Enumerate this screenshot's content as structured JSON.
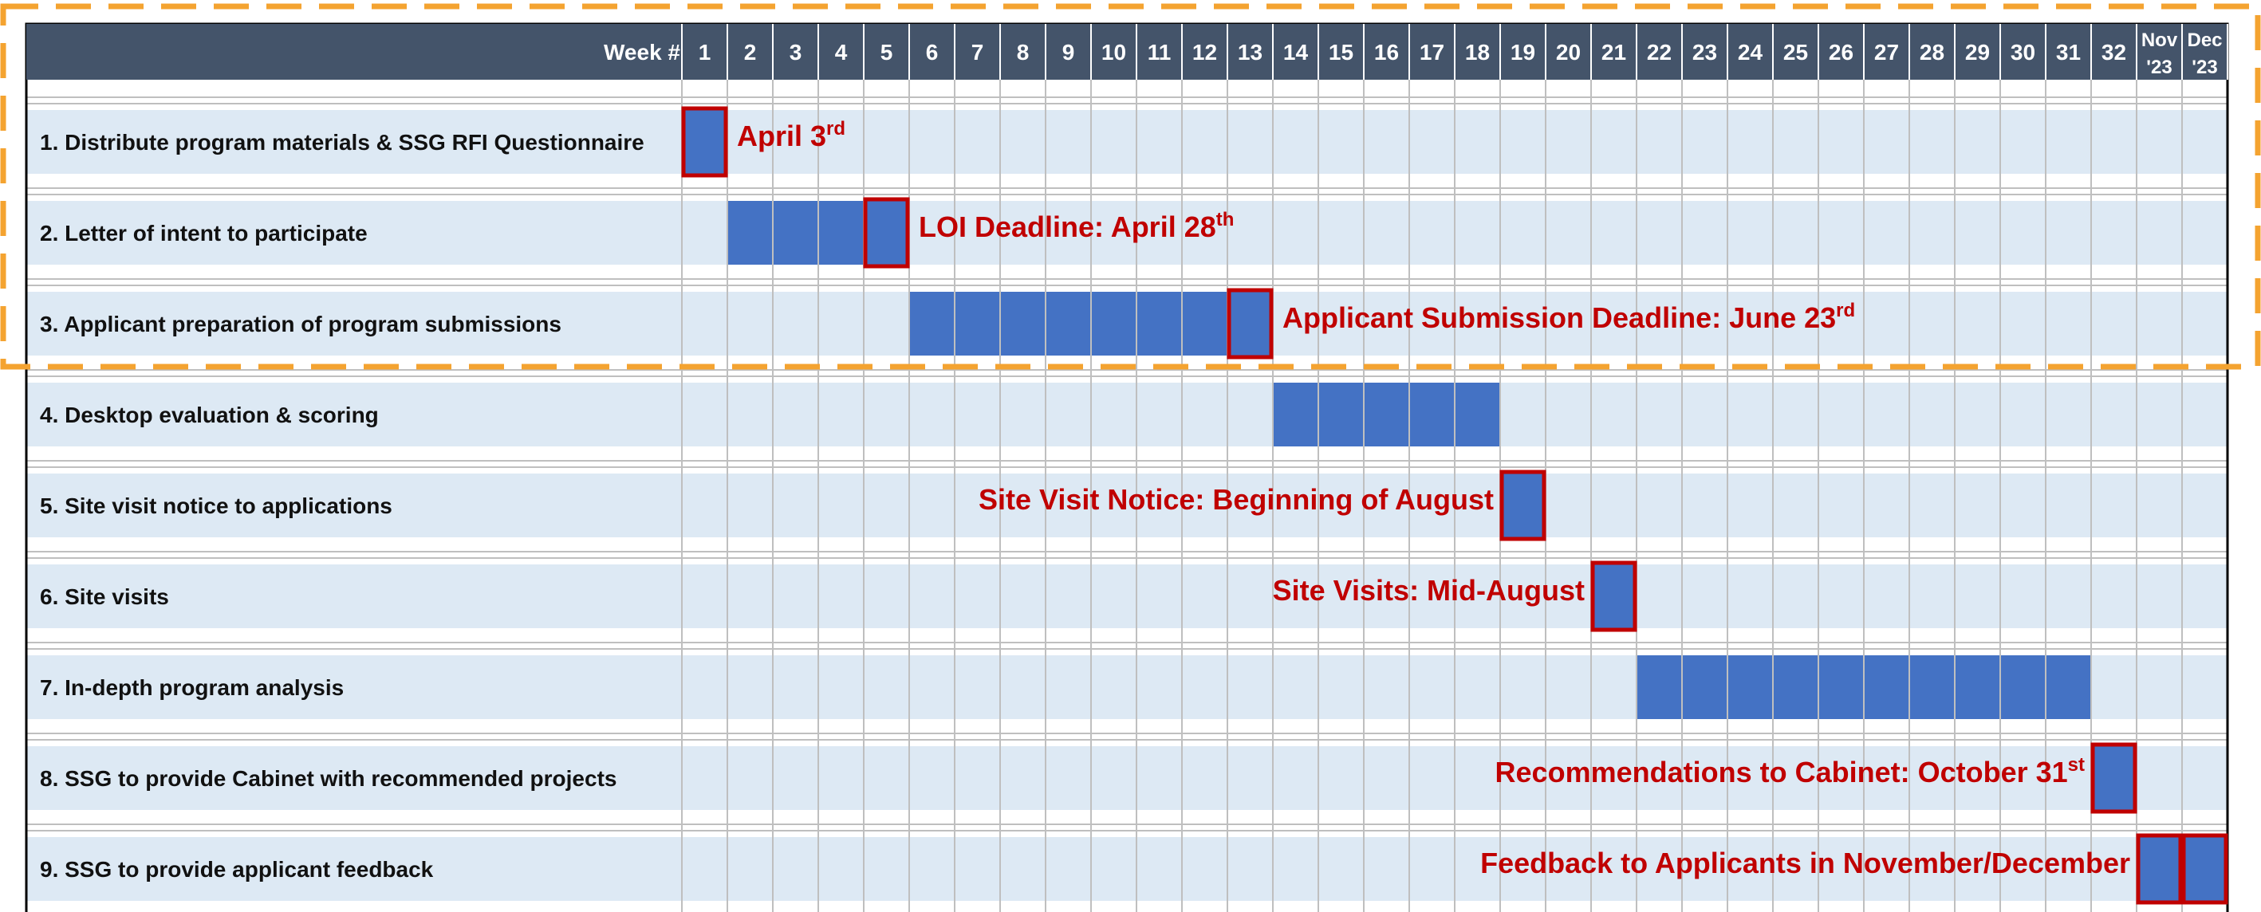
{
  "colors": {
    "header_bg": "#44546a",
    "row_band": "#dde9f4",
    "bar_fill": "#4472c4",
    "milestone_border": "#c00000",
    "annotation_text": "#c00000",
    "highlight_dash": "#f4a330",
    "grid_line": "#bfbfbf"
  },
  "chart_data": {
    "type": "gantt",
    "header_label": "Week #",
    "columns": [
      "1",
      "2",
      "3",
      "4",
      "5",
      "6",
      "7",
      "8",
      "9",
      "10",
      "11",
      "12",
      "13",
      "14",
      "15",
      "16",
      "17",
      "18",
      "19",
      "20",
      "21",
      "22",
      "23",
      "24",
      "25",
      "26",
      "27",
      "28",
      "29",
      "30",
      "31",
      "32",
      [
        "Nov",
        "'23"
      ],
      [
        "Dec",
        "'23"
      ]
    ],
    "tasks": [
      {
        "label": "1. Distribute program materials & SSG RFI Questionnaire",
        "start": 1,
        "end": 1,
        "milestones": [
          1
        ],
        "annotation": {
          "text": "April 3",
          "sup": "rd",
          "side": "right"
        }
      },
      {
        "label": "2. Letter of intent to participate",
        "start": 2,
        "end": 5,
        "milestones": [
          5
        ],
        "annotation": {
          "text": "LOI Deadline: April 28",
          "sup": "th",
          "side": "right"
        }
      },
      {
        "label": "3. Applicant preparation of program submissions",
        "start": 6,
        "end": 13,
        "milestones": [
          13
        ],
        "annotation": {
          "text": "Applicant Submission Deadline: June 23",
          "sup": "rd",
          "side": "right"
        }
      },
      {
        "label": "4. Desktop evaluation & scoring",
        "start": 14,
        "end": 18,
        "milestones": []
      },
      {
        "label": "5. Site visit notice to applications",
        "start": 19,
        "end": 19,
        "milestones": [
          19
        ],
        "annotation": {
          "text": "Site Visit Notice: Beginning of August",
          "sup": "",
          "side": "left"
        }
      },
      {
        "label": "6. Site visits",
        "start": 21,
        "end": 21,
        "milestones": [
          21
        ],
        "annotation": {
          "text": "Site Visits: Mid-August",
          "sup": "",
          "side": "left"
        }
      },
      {
        "label": "7. In-depth program analysis",
        "start": 22,
        "end": 31,
        "milestones": []
      },
      {
        "label": "8. SSG to provide Cabinet with recommended projects",
        "start": 32,
        "end": 32,
        "milestones": [
          32
        ],
        "annotation": {
          "text": "Recommendations to Cabinet: October 31",
          "sup": "st",
          "side": "left"
        }
      },
      {
        "label": "9. SSG to provide applicant feedback",
        "start": 33,
        "end": 34,
        "milestones": [
          33,
          34
        ],
        "annotation": {
          "text": "Feedback to Applicants in November/December",
          "sup": "",
          "side": "left"
        }
      }
    ],
    "highlight": {
      "rows": [
        1,
        3
      ]
    }
  }
}
